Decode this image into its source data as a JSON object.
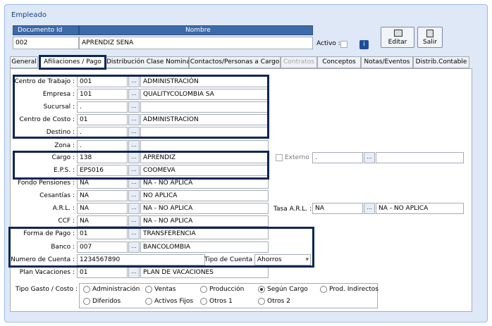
{
  "window": {
    "title": "Empleado"
  },
  "header": {
    "doc_label": "Documento Id",
    "name_label": "Nombre",
    "doc_value": "002",
    "name_value": "APRENDIZ SENA",
    "activo_label": "Activo :"
  },
  "toolbar": {
    "edit_label": "Editar",
    "exit_label": "Salir"
  },
  "tabs": [
    {
      "label": "General"
    },
    {
      "label": "Afiliaciones / Pago"
    },
    {
      "label": "Distribución Clase Nomina"
    },
    {
      "label": "Contactos/Personas a Cargo"
    },
    {
      "label": "Contratos"
    },
    {
      "label": "Conceptos"
    },
    {
      "label": "Notas/Eventos"
    },
    {
      "label": "Distrib.Contable"
    }
  ],
  "fields": {
    "centro_trabajo": {
      "label": "Centro de Trabajo :",
      "code": "001",
      "desc": "ADMINISTRACIÓN"
    },
    "empresa": {
      "label": "Empresa :",
      "code": "101",
      "desc": "QUALITYCOLOMBIA SA"
    },
    "sucursal": {
      "label": "Sucursal :",
      "code": ".",
      "desc": ""
    },
    "centro_costo": {
      "label": "Centro de Costo :",
      "code": "01",
      "desc": "ADMINISTRACION"
    },
    "destino": {
      "label": "Destino :",
      "code": ".",
      "desc": ""
    },
    "zona": {
      "label": "Zona :",
      "code": ".",
      "desc": ""
    },
    "cargo": {
      "label": "Cargo :",
      "code": "138",
      "desc": "APRENDIZ"
    },
    "eps": {
      "label": "E.P.S. :",
      "code": "EPS016",
      "desc": "COOMEVA"
    },
    "fondo_pensiones": {
      "label": "Fondo Pensiones :",
      "code": "NA",
      "desc": "NA - NO APLICA"
    },
    "cesantias": {
      "label": "Cesantías :",
      "code": "NA",
      "desc": "NO APLICA"
    },
    "arl": {
      "label": "A.R.L. :",
      "code": "NA",
      "desc": "NA - NO APLICA"
    },
    "ccf": {
      "label": "CCF :",
      "code": "NA",
      "desc": "NA - NO APLICA"
    },
    "forma_pago": {
      "label": "Forma de Pago :",
      "code": "01",
      "desc": "TRANSFERENCIA"
    },
    "banco": {
      "label": "Banco :",
      "code": "007",
      "desc": "BANCOLOMBIA"
    },
    "numero_cuenta": {
      "label": "Numero de Cuenta :",
      "value": "1234567890"
    },
    "tipo_cuenta": {
      "label": "Tipo de Cuenta :",
      "value": "Ahorros"
    },
    "plan_vacaciones": {
      "label": "Plan Vacaciones :",
      "code": "01",
      "desc": "PLAN DE VACACIONES"
    },
    "externo": {
      "label": "Externo",
      "code": ".",
      "desc": ""
    },
    "tasa_arl": {
      "label": "Tasa A.R.L. :",
      "code": "NA",
      "desc": "NA - NO APLICA"
    }
  },
  "browse_glyph": "...",
  "dropdown_glyph": "▾",
  "tipo_gasto": {
    "label": "Tipo Gasto / Costo :",
    "options": [
      "Administración",
      "Ventas",
      "Producción",
      "Según Cargo",
      "Prod. Indirectos",
      "Diferidos",
      "Activos Fijos",
      "Otros 1",
      "Otros 2"
    ],
    "selected": "Según Cargo"
  },
  "colors": {
    "header_bg": "#3d6aa8",
    "window_bg": "#dfe8f6",
    "highlight": "#0f2557"
  }
}
